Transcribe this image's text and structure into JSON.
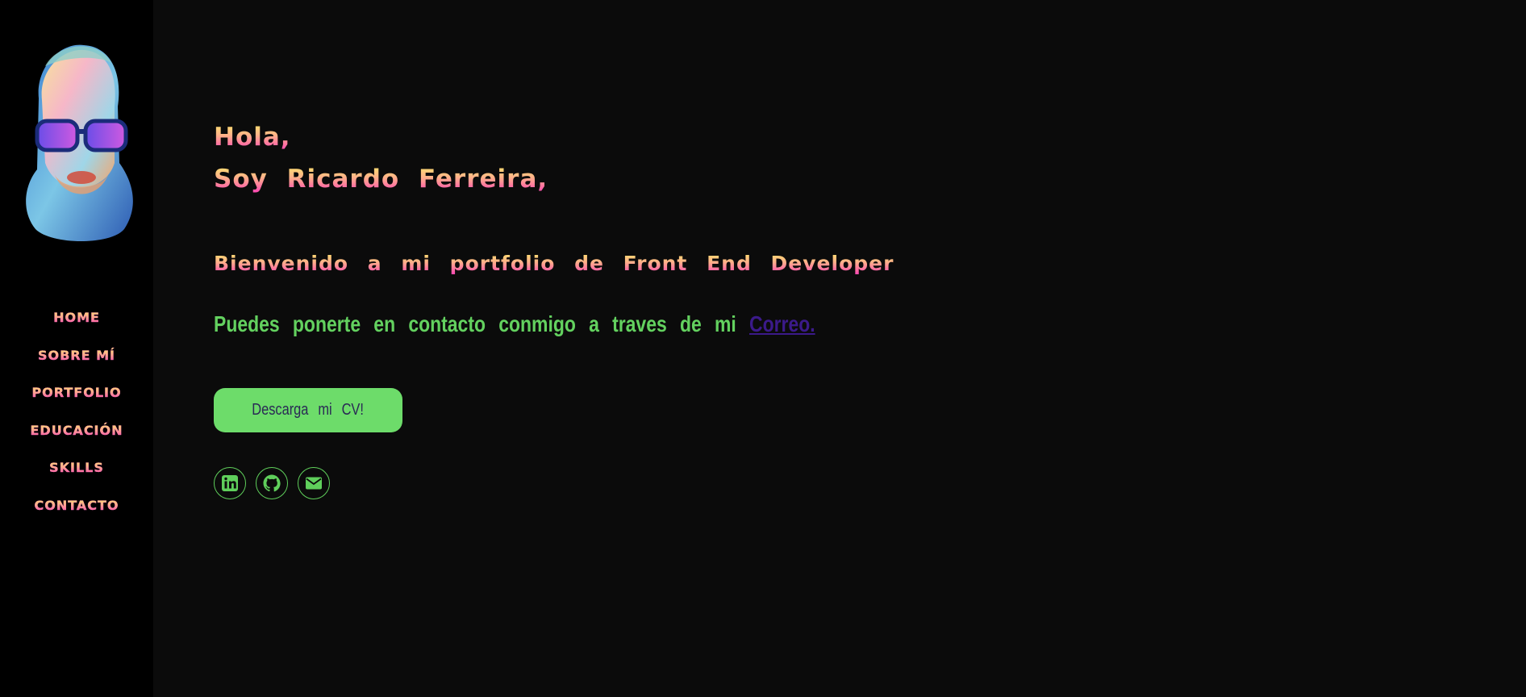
{
  "sidebar": {
    "avatar_icon": "watercolor-portrait",
    "nav": [
      {
        "label": "HOME"
      },
      {
        "label": "SOBRE MÍ"
      },
      {
        "label": "PORTFOLIO"
      },
      {
        "label": "EDUCACIÓN"
      },
      {
        "label": "SKILLS"
      },
      {
        "label": "CONTACTO"
      }
    ]
  },
  "hero": {
    "greeting_line1": "Hola,",
    "greeting_line2": "Soy Ricardo Ferreira,",
    "welcome": "Bienvenido a mi portfolio de Front End Developer",
    "contact_text": "Puedes ponerte en contacto conmigo a traves de mi ",
    "contact_link": "Correo.",
    "cv_button": "Descarga mi CV!"
  },
  "socials": [
    {
      "icon": "linkedin-icon"
    },
    {
      "icon": "github-icon"
    },
    {
      "icon": "envelope-icon"
    }
  ],
  "colors": {
    "background": "#0b0b0b",
    "sidebar": "#000000",
    "accent_green": "#6ddc6a",
    "link_purple": "#3b1a8a",
    "gradient_top": "#ffe86a",
    "gradient_bottom": "#ff3fb6"
  }
}
